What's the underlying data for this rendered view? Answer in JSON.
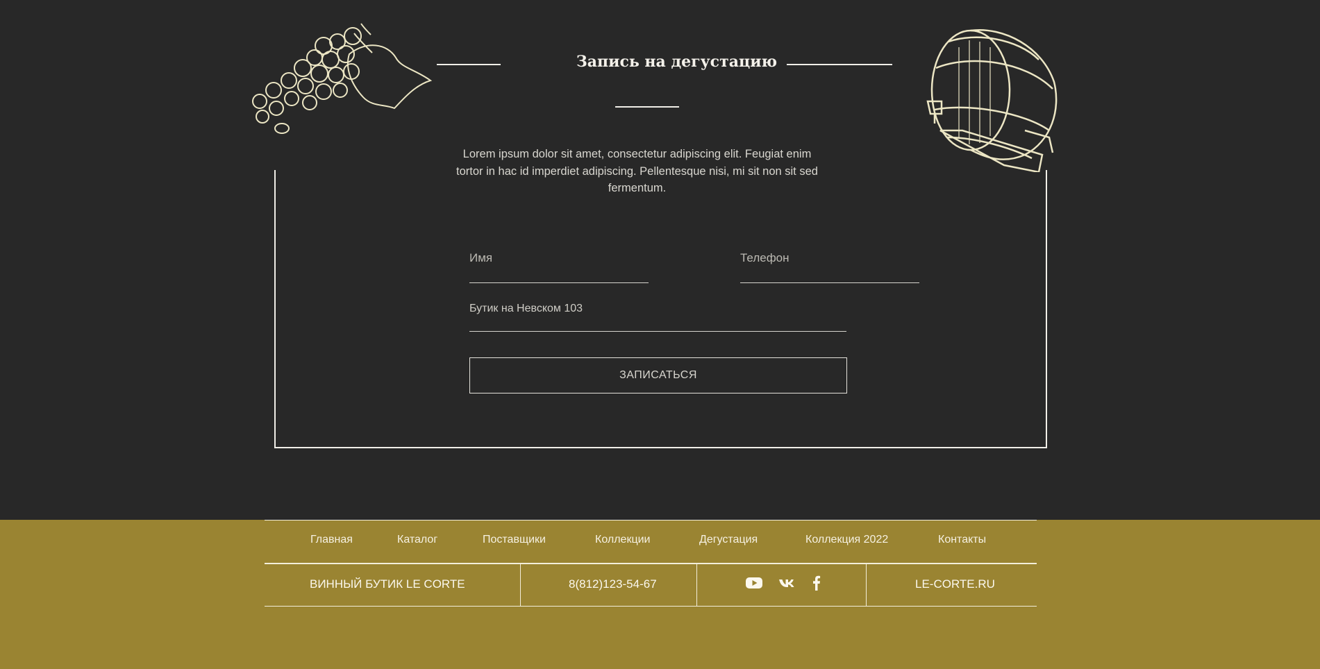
{
  "form": {
    "title": "Запись на дегустацию",
    "description": "Lorem ipsum dolor sit amet, consectetur adipiscing elit. Feugiat enim tortor in hac id imperdiet adipiscing. Pellentesque nisi, mi sit non sit sed fermentum.",
    "name_placeholder": "Имя",
    "phone_placeholder": "Телефон",
    "boutique_value": "Бутик на Невском 103",
    "submit_label": "ЗАПИСАТЬСЯ"
  },
  "footer": {
    "nav": [
      "Главная",
      "Каталог",
      "Поставщики",
      "Коллекции",
      "Дегустация",
      "Коллекция 2022",
      "Контакты"
    ],
    "brand": "ВИННЫЙ БУТИК LE CORTE",
    "phone": "8(812)123-54-67",
    "site": "LE-CORTE.RU",
    "social_icons": [
      "youtube-icon",
      "vk-icon",
      "facebook-icon"
    ]
  },
  "colors": {
    "background": "#282828",
    "footer": "#9a8432",
    "illustration": "#ece6c4"
  }
}
